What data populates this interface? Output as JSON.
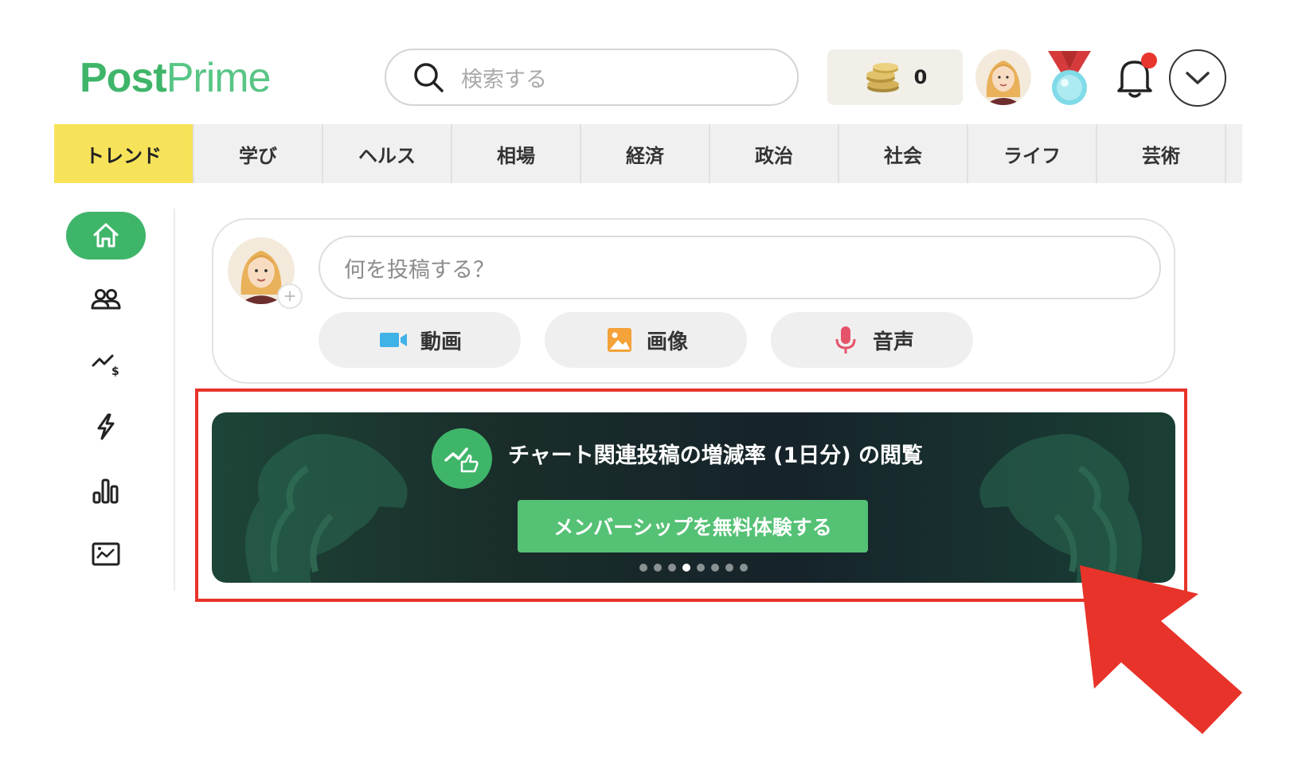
{
  "header": {
    "logo_part1": "Post",
    "logo_part2": "Prime",
    "search_placeholder": "検索する",
    "coin_count": "0"
  },
  "tabs": [
    {
      "label": "トレンド",
      "active": true
    },
    {
      "label": "学び"
    },
    {
      "label": "ヘルス"
    },
    {
      "label": "相場"
    },
    {
      "label": "経済"
    },
    {
      "label": "政治"
    },
    {
      "label": "社会"
    },
    {
      "label": "ライフ"
    },
    {
      "label": "芸術"
    }
  ],
  "sidebar": {
    "icons": [
      "home-icon",
      "people-icon",
      "trend-dollar-icon",
      "lightning-icon",
      "bar-chart-icon",
      "chart-image-icon"
    ]
  },
  "composer": {
    "placeholder": "何を投稿する？",
    "video_label": "動画",
    "image_label": "画像",
    "audio_label": "音声"
  },
  "banner": {
    "title": "チャート関連投稿の増減率 (1日分) の閲覧",
    "button_label": "メンバーシップを無料体験する",
    "slide_count": 8,
    "active_slide": 4
  },
  "colors": {
    "brand_green": "#3fb56a",
    "active_tab": "#f7e35a",
    "highlight_red": "#e8332a"
  }
}
